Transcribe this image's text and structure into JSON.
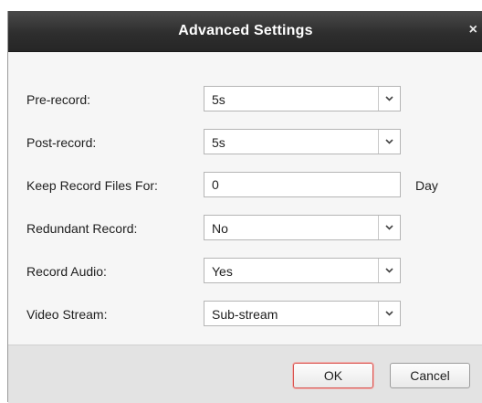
{
  "dialog": {
    "title": "Advanced Settings",
    "close_glyph": "×"
  },
  "fields": {
    "prerecord": {
      "label": "Pre-record:",
      "value": "5s"
    },
    "postrecord": {
      "label": "Post-record:",
      "value": "5s"
    },
    "keep": {
      "label": "Keep Record Files For:",
      "value": "0",
      "unit": "Day"
    },
    "redundant": {
      "label": "Redundant Record:",
      "value": "No"
    },
    "audio": {
      "label": "Record Audio:",
      "value": "Yes"
    },
    "stream": {
      "label": "Video Stream:",
      "value": "Sub-stream"
    }
  },
  "buttons": {
    "ok": "OK",
    "cancel": "Cancel"
  },
  "icons": {
    "dropdown": "chevron-down-icon",
    "close": "close-icon"
  },
  "colors": {
    "titlebar": "#2e2e2e",
    "ok_border": "#d9534f",
    "footer": "#e3e3e3"
  }
}
